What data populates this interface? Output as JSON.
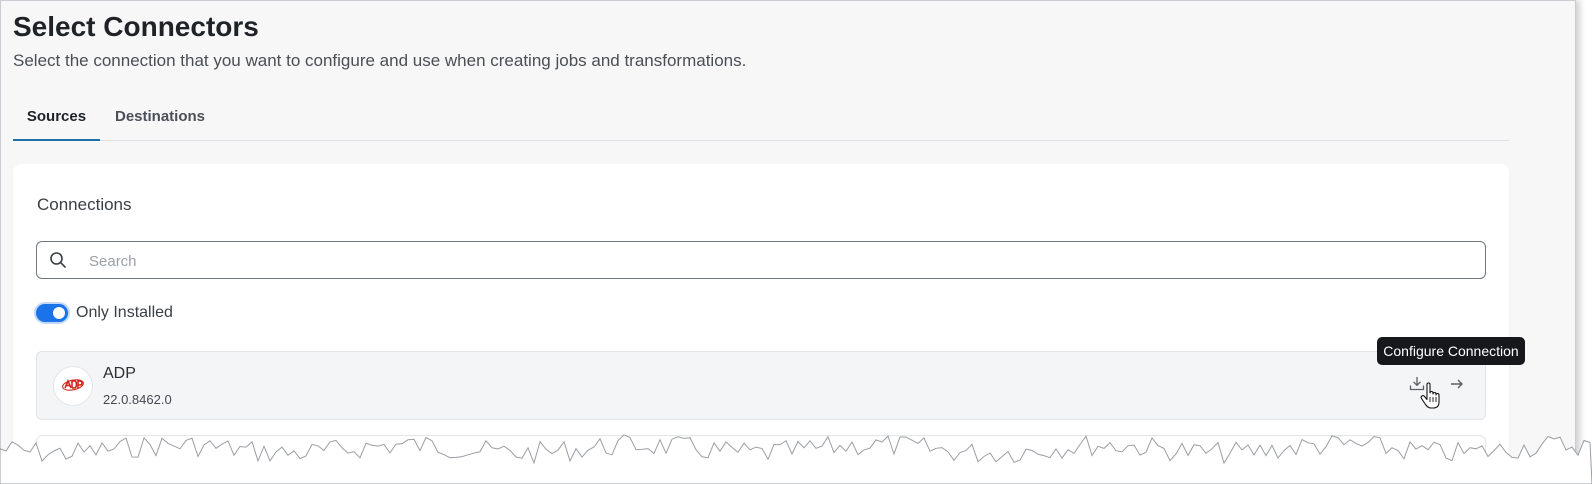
{
  "page": {
    "title": "Select Connectors",
    "subtitle": "Select the connection that you want to configure and use when creating jobs and transformations."
  },
  "tabs": [
    {
      "label": "Sources",
      "active": true
    },
    {
      "label": "Destinations",
      "active": false
    }
  ],
  "connections": {
    "title": "Connections",
    "search_placeholder": "Search",
    "search_value": "",
    "search_icon": "search-icon",
    "toggle": {
      "label": "Only Installed",
      "on": true
    },
    "items": [
      {
        "name": "ADP",
        "version": "22.0.8462.0",
        "logo_icon": "adp-logo",
        "actions": [
          {
            "icon": "download-icon"
          },
          {
            "icon": "configure-icon"
          }
        ]
      }
    ]
  },
  "tooltip": {
    "text": "Configure Connection"
  },
  "colors": {
    "accent": "#1a73e8",
    "tab_indicator": "#1d6fa5",
    "tooltip_bg": "#16181b",
    "logo_red": "#d0271d"
  }
}
